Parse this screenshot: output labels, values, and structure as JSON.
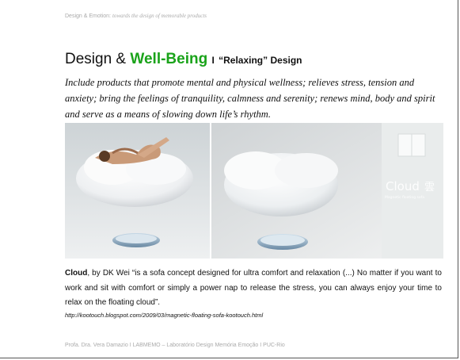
{
  "header": {
    "prefix": "Design & Emotion:",
    "subtitle": "towards the design of memorable products"
  },
  "title": {
    "part1": "Design &",
    "highlight": "Well-Being",
    "separator": "I",
    "subtitle": "“Relaxing” Design"
  },
  "intro": "Include products that promote mental and physical wellness; relieves stress, tension and anxiety; bring the feelings of tranquility, calmness and serenity; renews mind, body and spirit and serve as a means of slowing down life’s rhythm.",
  "photo": {
    "brand": "Cloud",
    "brand_cjk": "雲",
    "brand_tagline": "Magnetic floating sofa"
  },
  "caption": {
    "name": "Cloud",
    "text": ", by DK Wei “is a sofa concept designed for ultra comfort and relaxation (...) No matter if you want to work and sit with comfort or simply a power nap to release the stress, you can always enjoy your time to relax on the floating cloud”."
  },
  "url": "http://kootouch.blogspot.com/2009/03/magnetic-floating-sofa-kootouch.html",
  "footer": "Profa. Dra. Vera Damazio I LABMEMO – Laboratório Design Memória Emoção I PUC-Rio"
}
